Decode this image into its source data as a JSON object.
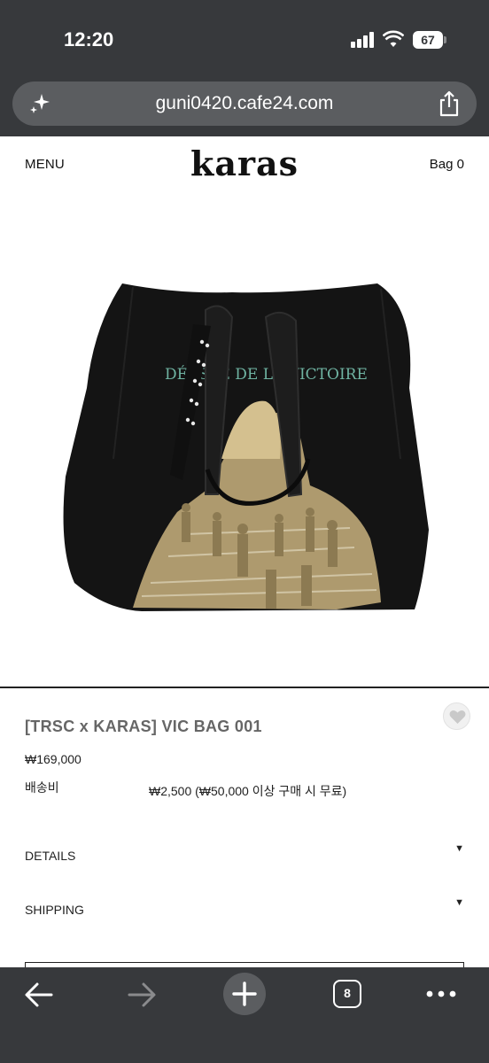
{
  "status_bar": {
    "time": "12:20",
    "battery": "67"
  },
  "browser": {
    "url": "guni0420.cafe24.com",
    "tab_count": "8",
    "icons": [
      "sparkle-icon",
      "share-icon",
      "back-arrow-icon",
      "forward-arrow-icon",
      "plus-icon",
      "more-icon"
    ]
  },
  "header": {
    "menu_label": "MENU",
    "logo": "karas",
    "bag_label": "Bag 0"
  },
  "product": {
    "image_alt": "black tote bag with printed victory artwork",
    "bag_print_text": "DÉESSE DE LA VICTOIRE",
    "name": "[TRSC x KARAS] VIC BAG 001",
    "price": "₩169,000",
    "shipping_label": "배송비",
    "shipping_value": "₩2,500 (₩50,000 이상 구매 시 무료)",
    "wishlist_icon": "heart-icon"
  },
  "sections": [
    {
      "label": "DETAILS",
      "icon": "caret-down-icon"
    },
    {
      "label": "SHIPPING",
      "icon": "caret-down-icon"
    }
  ],
  "colors": {
    "chrome_dark": "#37393c",
    "chrome_pill": "#5b5d60",
    "bag_black": "#141414",
    "print_gold": "#c9b27e",
    "print_teal": "#6fb3a2"
  }
}
